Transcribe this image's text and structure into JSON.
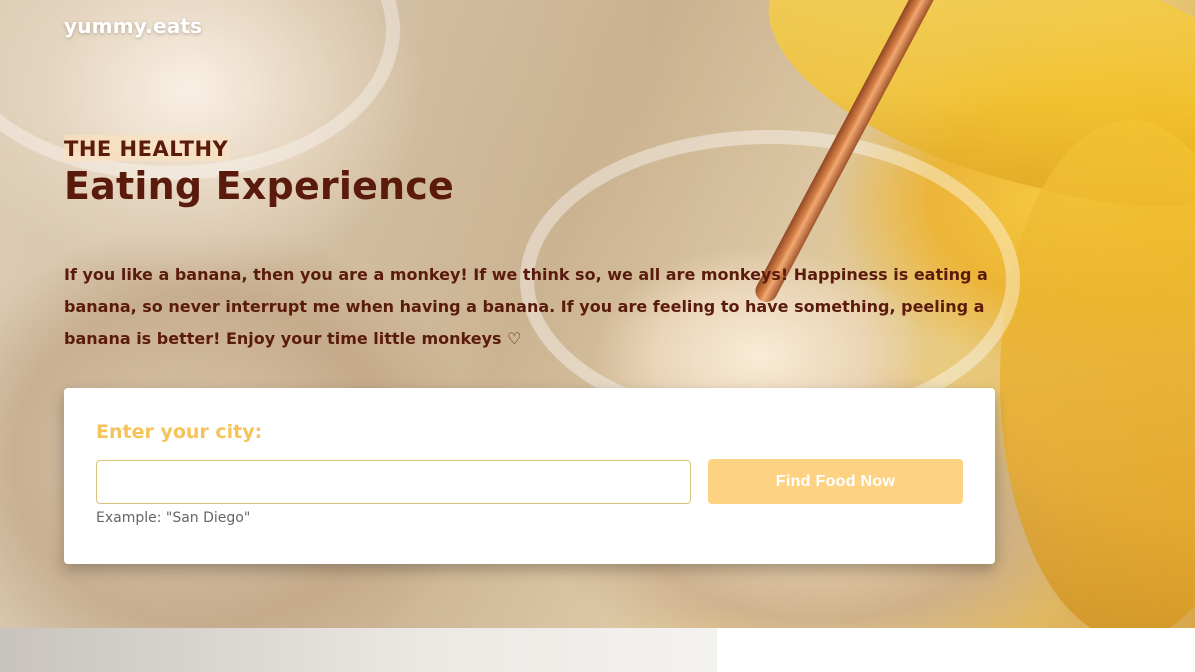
{
  "brand": {
    "logo_text": "yummy.eats"
  },
  "hero": {
    "kicker": "THE HEALTHY",
    "headline": "Eating Experience",
    "intro": "If you like a banana, then you are a monkey! If we think so, we all are monkeys! Happiness is eating a banana, so never interrupt me when having a banana. If you are feeling to have something, peeling a banana is better! Enjoy your time little monkeys ♡"
  },
  "search": {
    "label": "Enter your city:",
    "input_value": "",
    "hint": "Example: \"San Diego\"",
    "button_label": "Find Food Now"
  },
  "colors": {
    "heading_text": "#5a1a0c",
    "label_yellow": "#f5c35a",
    "button_bg": "#fdd383",
    "button_text": "#ffffff"
  }
}
